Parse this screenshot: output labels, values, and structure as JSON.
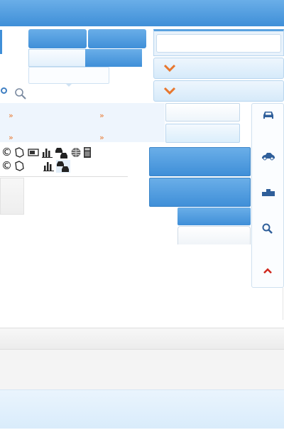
{
  "header": {
    "title": ""
  },
  "tabs": [
    {
      "label": ""
    },
    {
      "label": ""
    },
    {
      "label": ""
    },
    {
      "label": ""
    }
  ],
  "search": {
    "placeholder": "",
    "value": ""
  },
  "dropdowns": [
    {
      "icon": "chevron-down-icon",
      "label": ""
    },
    {
      "icon": "chevron-down-icon",
      "label": ""
    }
  ],
  "links": [
    {
      "label": ""
    },
    {
      "label": ""
    },
    {
      "label": ""
    },
    {
      "label": ""
    }
  ],
  "side_toolbar": [
    {
      "icon": "car-front-icon"
    },
    {
      "icon": "car-side-icon"
    },
    {
      "icon": "podium-icon"
    },
    {
      "icon": "search-icon"
    },
    {
      "icon": "caret-up-icon"
    }
  ],
  "colors": {
    "accent": "#3f8fd8",
    "arrow": "#e8772e",
    "icon": "#2f5f9a"
  }
}
